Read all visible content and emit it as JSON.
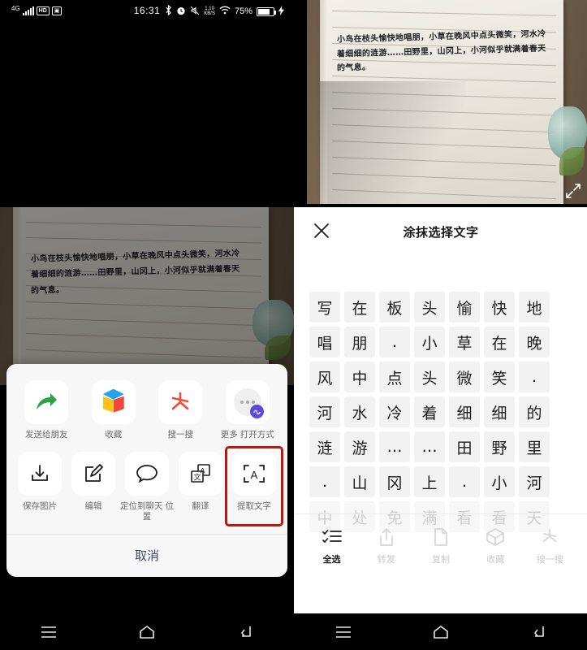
{
  "status_bar": {
    "network": "4G",
    "hd_badge": "HD",
    "sim_badge": "SIM",
    "time": "16:31",
    "speed_value": "1.10",
    "speed_unit": "KB/S",
    "battery_percent": "75%",
    "icons": [
      "bluetooth-icon",
      "alarm-icon",
      "mute-icon",
      "wifi-icon",
      "battery-icon",
      "charging-icon"
    ]
  },
  "photo": {
    "handwriting_lines": [
      "小鸟在枝头愉快地唱朋，小草在晚风中点头微笑，河水冷",
      "着细细的涟游……田野里，山冈上，小河似乎就满着春天",
      "的气息。"
    ],
    "expand_icon": "expand-icon"
  },
  "share_sheet": {
    "row1": [
      {
        "label": "发送给朋友",
        "icon": "forward-arrow-icon"
      },
      {
        "label": "收藏",
        "icon": "favorite-cube-icon"
      },
      {
        "label": "搜一搜",
        "icon": "search-asterisk-icon"
      },
      {
        "label": "更多\n打开方式",
        "icon": "more-options-icon"
      }
    ],
    "row2": [
      {
        "label": "保存图片",
        "icon": "download-icon"
      },
      {
        "label": "编辑",
        "icon": "edit-pencil-icon"
      },
      {
        "label": "定位到聊天\n位置",
        "icon": "chat-bubble-icon"
      },
      {
        "label": "翻译",
        "icon": "translate-icon"
      },
      {
        "label": "提取文字",
        "icon": "extract-text-icon",
        "highlighted": true
      }
    ],
    "cancel_label": "取消",
    "highlight_color": "#c0160c"
  },
  "ocr_panel": {
    "title": "涂抹选择文字",
    "close_icon": "close-icon",
    "rows": [
      {
        "chars": [
          "写",
          "在",
          "板",
          "头",
          "愉",
          "快",
          "地"
        ],
        "faded": false
      },
      {
        "chars": [
          "唱",
          "朋",
          ".",
          "小",
          "草",
          "在",
          "晚"
        ],
        "faded": false
      },
      {
        "chars": [
          "风",
          "中",
          "点",
          "头",
          "微",
          "笑",
          "."
        ],
        "faded": false
      },
      {
        "chars": [
          "河",
          "水",
          "冷",
          "着",
          "细",
          "细",
          "的"
        ],
        "faded": false
      },
      {
        "chars": [
          "涟",
          "游",
          "…",
          "…",
          "田",
          "野",
          "里"
        ],
        "faded": false
      },
      {
        "chars": [
          ".",
          "山",
          "冈",
          "上",
          ".",
          "小",
          "河"
        ],
        "faded": false
      },
      {
        "chars": [
          "中",
          "处",
          "免",
          "满",
          "看",
          "看",
          "天"
        ],
        "faded": true
      }
    ],
    "toolbar": [
      {
        "label": "全选",
        "icon": "select-all-icon",
        "active": true
      },
      {
        "label": "转发",
        "icon": "share-icon",
        "active": false
      },
      {
        "label": "复制",
        "icon": "copy-icon",
        "active": false
      },
      {
        "label": "收藏",
        "icon": "favorite-icon",
        "active": false
      },
      {
        "label": "搜一搜",
        "icon": "search-icon",
        "active": false
      }
    ]
  },
  "nav_bar": {
    "items": [
      {
        "icon": "menu-icon"
      },
      {
        "icon": "home-icon"
      },
      {
        "icon": "back-icon"
      }
    ]
  }
}
